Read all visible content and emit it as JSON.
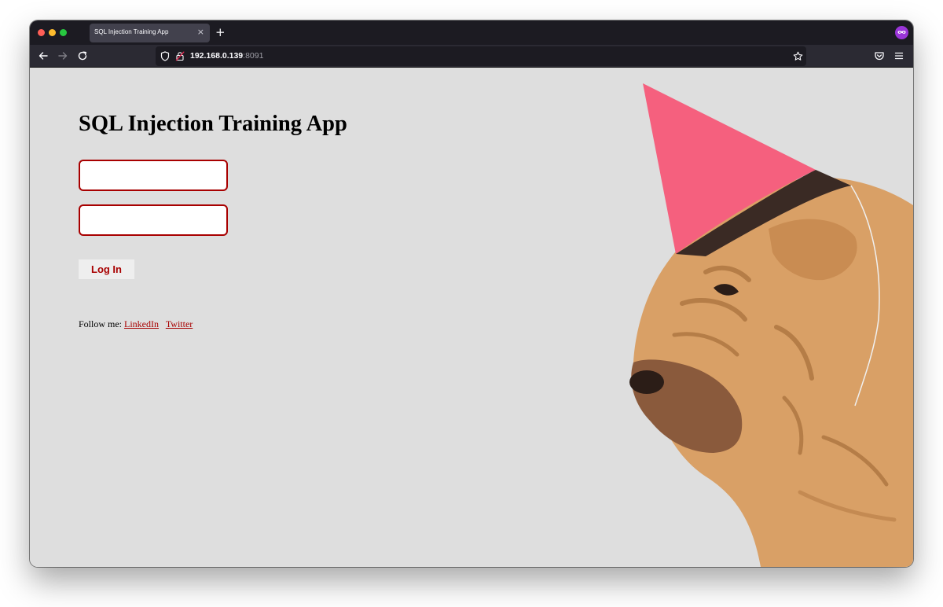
{
  "browser": {
    "tab_title": "SQL Injection Training App",
    "tab_close": "×",
    "new_tab": "+",
    "url_host": "192.168.0.139",
    "url_port": ":8091"
  },
  "page": {
    "heading": "SQL Injection Training App",
    "username_value": "",
    "password_value": "",
    "login_label": "Log In",
    "follow_label": "Follow me:",
    "linkedin_label": "LinkedIn",
    "twitter_label": "Twitter",
    "illustration": "dog with pink party hat"
  },
  "colors": {
    "accent": "#a80000",
    "page_bg": "#dedede",
    "titlebar_bg": "#1c1b22",
    "toolbar_bg": "#2b2a33",
    "hat": "#f5607e",
    "dog": "#d9a066"
  }
}
